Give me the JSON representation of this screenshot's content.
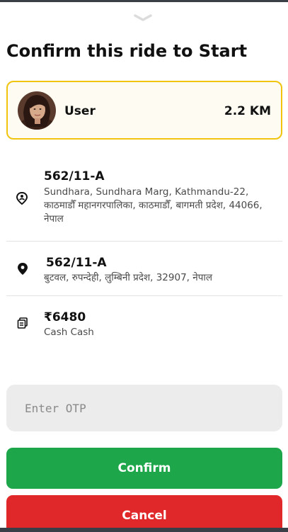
{
  "sheet": {
    "handle_icon": "chevron-down-icon",
    "title": "Confirm this ride to Start"
  },
  "user_card": {
    "name": "User",
    "distance": "2.2 KM",
    "border_color": "#f1c40f"
  },
  "pickup": {
    "icon": "pickup-pin-icon",
    "title": "562/11-A",
    "address": "Sundhara, Sundhara Marg, Kathmandu-22, काठमाडौँ महानगरपालिका, काठमाडौँ, बागमती प्रदेश, 44066, नेपाल"
  },
  "destination": {
    "icon": "location-pin-icon",
    "title": "562/11-A",
    "address": "बुटवल, रुपन्देही, लुम्बिनी प्रदेश, 32907, नेपाल"
  },
  "fare": {
    "icon": "cash-icon",
    "amount": "₹6480",
    "method": "Cash Cash"
  },
  "otp": {
    "placeholder": "Enter OTP",
    "value": ""
  },
  "actions": {
    "confirm_label": "Confirm",
    "cancel_label": "Cancel",
    "confirm_color": "#1da74a",
    "cancel_color": "#e0282a"
  }
}
